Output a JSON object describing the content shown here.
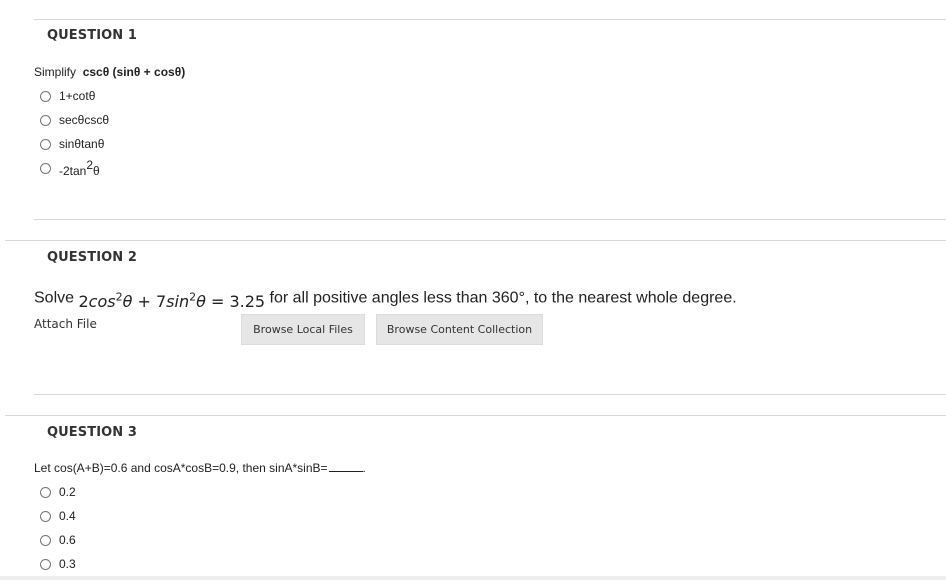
{
  "question1": {
    "heading": "QUESTION 1",
    "prompt_prefix": "Simplify",
    "prompt_expression": "cscθ (sinθ + cosθ)",
    "options": [
      {
        "label": "1+cotθ"
      },
      {
        "label": "secθcscθ"
      },
      {
        "label": "sinθtanθ"
      },
      {
        "label": "-2tan",
        "sup": "2",
        "suffix": "θ"
      }
    ]
  },
  "question2": {
    "heading": "QUESTION 2",
    "prompt_prefix": "Solve",
    "equation": {
      "coef1": "2",
      "fn1": "cos",
      "exp1": "2",
      "var1": "θ",
      "op": " + ",
      "coef2": "7",
      "fn2": "sin",
      "exp2": "2",
      "var2": "θ",
      "rhs": " = 3.25"
    },
    "prompt_suffix": "for all positive angles less than 360°, to the nearest whole degree.",
    "attach_label": "Attach File",
    "browse_local_label": "Browse Local Files",
    "browse_content_label": "Browse Content Collection"
  },
  "question3": {
    "heading": "QUESTION 3",
    "prompt": "Let cos(A+B)=0.6 and cosA*cosB=0.9, then sinA*sinB=",
    "prompt_end": ".",
    "options": [
      {
        "label": "0.2"
      },
      {
        "label": "0.4"
      },
      {
        "label": "0.6"
      },
      {
        "label": "0.3"
      }
    ]
  }
}
